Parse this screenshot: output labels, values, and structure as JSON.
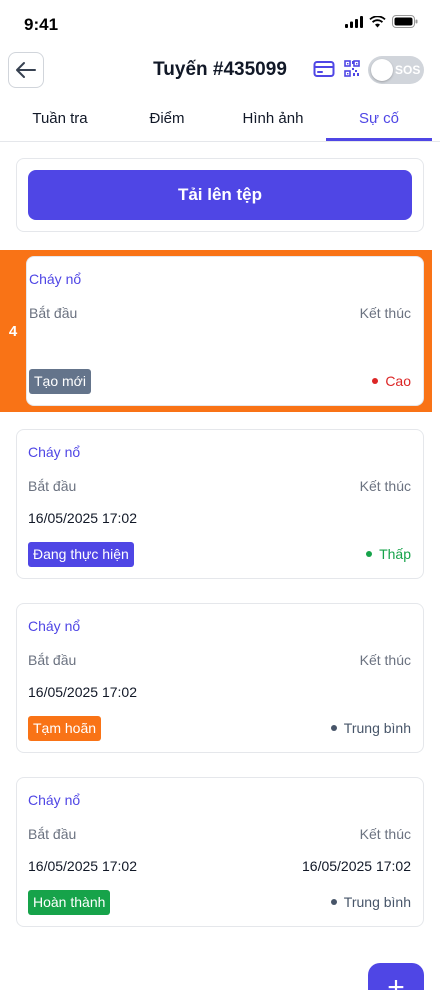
{
  "status_bar": {
    "time": "9:41"
  },
  "header": {
    "title": "Tuyến #435099",
    "sos_label": "SOS"
  },
  "tabs": [
    {
      "label": "Tuần tra",
      "active": false
    },
    {
      "label": "Điểm",
      "active": false
    },
    {
      "label": "Hình ảnh",
      "active": false
    },
    {
      "label": "Sự cố",
      "active": true
    }
  ],
  "upload": {
    "label": "Tải lên tệp"
  },
  "highlight": {
    "number": "4"
  },
  "incidents": [
    {
      "type": "Cháy nổ",
      "start_label": "Bắt đầu",
      "end_label": "Kết thúc",
      "start": "",
      "end": "",
      "status": "Tạo mới",
      "status_color": "#64748b",
      "priority": "Cao",
      "priority_color": "#dc2626"
    },
    {
      "type": "Cháy nổ",
      "start_label": "Bắt đầu",
      "end_label": "Kết thúc",
      "start": "16/05/2025 17:02",
      "end": "",
      "status": "Đang thực hiện",
      "status_color": "#4f46e5",
      "priority": "Thấp",
      "priority_color": "#16a34a"
    },
    {
      "type": "Cháy nổ",
      "start_label": "Bắt đầu",
      "end_label": "Kết thúc",
      "start": "16/05/2025 17:02",
      "end": "",
      "status": "Tạm hoãn",
      "status_color": "#f97316",
      "priority": "Trung bình",
      "priority_color": "#475569"
    },
    {
      "type": "Cháy nổ",
      "start_label": "Bắt đầu",
      "end_label": "Kết thúc",
      "start": "16/05/2025 17:02",
      "end": "16/05/2025 17:02",
      "status": "Hoàn thành",
      "status_color": "#16a34a",
      "priority": "Trung bình",
      "priority_color": "#475569"
    }
  ],
  "fab": {
    "label": "+"
  },
  "colors": {
    "accent": "#4f46e5",
    "highlight": "#f97316"
  }
}
